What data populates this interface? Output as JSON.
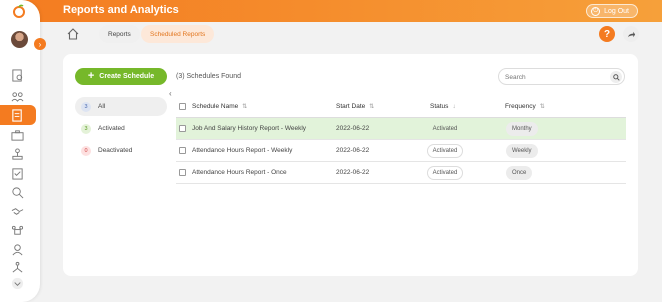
{
  "app": {
    "title": "Reports and Analytics",
    "logout_label": "Log Out"
  },
  "breadcrumb": {
    "reports": "Reports",
    "scheduled": "Scheduled Reports"
  },
  "help_label": "?",
  "sidebar": {
    "icons": [
      "reports-icon",
      "team-icon",
      "scheduled-report-icon",
      "briefcase-icon",
      "org-chart-icon",
      "clipboard-icon",
      "search-user-icon",
      "handshake-icon",
      "meeting-icon",
      "user-settings-icon",
      "hierarchy-icon",
      "chevron-down-icon"
    ]
  },
  "actions": {
    "create_label": "Create Schedule"
  },
  "filters": [
    {
      "count": "3",
      "label": "All"
    },
    {
      "count": "3",
      "label": "Activated"
    },
    {
      "count": "0",
      "label": "Deactivated"
    }
  ],
  "found_text": "(3) Schedules Found",
  "search": {
    "placeholder": "Search"
  },
  "table": {
    "headers": {
      "name": "Schedule Name",
      "date": "Start Date",
      "status": "Status",
      "frequency": "Frequency"
    },
    "rows": [
      {
        "name": "Job And Salary History Report - Weekly",
        "date": "2022-06-22",
        "status": "Activated",
        "frequency": "Monthy"
      },
      {
        "name": "Attendance Hours Report - Weekly",
        "date": "2022-06-22",
        "status": "Activated",
        "frequency": "Weekly"
      },
      {
        "name": "Attendance Hours Report - Once",
        "date": "2022-06-22",
        "status": "Activated",
        "frequency": "Once"
      }
    ]
  },
  "colors": {
    "accent": "#f47b20",
    "green": "#76b82a"
  }
}
